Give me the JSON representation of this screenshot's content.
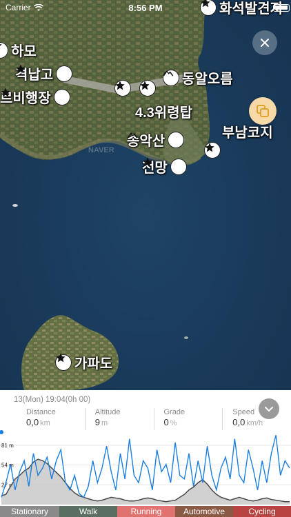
{
  "status_bar": {
    "carrier": "Carrier",
    "time": "8:56 PM"
  },
  "map": {
    "labels": [
      {
        "text": "화석발견지",
        "icon": "star"
      },
      {
        "text": "하모",
        "icon": "star"
      },
      {
        "text": "격납고",
        "icon": "star"
      },
      {
        "text": "르비행장",
        "icon": "star"
      },
      {
        "text": "동알오름",
        "icon": "mountain"
      },
      {
        "text": "4.3위령탑",
        "icon": "star"
      },
      {
        "text": "송악산",
        "icon": "mountain"
      },
      {
        "text": "전망",
        "icon": "star"
      },
      {
        "text": "부남코지",
        "icon": "star"
      },
      {
        "text": "가파도",
        "icon": "star"
      }
    ],
    "watermark": "NAVER"
  },
  "panel": {
    "datetime": "13(Mon) 19:04(0h 00)",
    "stats": [
      {
        "label": "Distance",
        "value": "0,0",
        "unit": "km"
      },
      {
        "label": "Altitude",
        "value": "9",
        "unit": "m"
      },
      {
        "label": "Grade",
        "value": "0",
        "unit": "%"
      },
      {
        "label": "Speed",
        "value": "0,0",
        "unit": "km/h"
      }
    ]
  },
  "chart_data": {
    "type": "line",
    "y_ticks": [
      "81 m",
      "54 m",
      "27 m"
    ],
    "altitude": [
      12,
      14,
      25,
      35,
      40,
      46,
      50,
      58,
      62,
      60,
      56,
      50,
      44,
      38,
      30,
      22,
      16,
      12,
      10,
      8,
      6,
      5,
      6,
      8,
      10,
      9,
      8,
      6,
      5,
      5,
      6,
      8,
      9,
      8,
      6,
      5,
      4,
      5,
      6,
      10,
      14,
      20,
      24,
      30,
      34,
      28,
      20,
      14,
      10,
      8,
      6,
      8,
      10,
      8,
      6,
      5,
      6,
      8,
      9,
      7,
      6,
      5,
      4,
      4
    ],
    "speed": [
      10,
      30,
      55,
      20,
      45,
      60,
      25,
      70,
      40,
      50,
      65,
      35,
      60,
      75,
      30,
      20,
      40,
      15,
      10,
      25,
      60,
      30,
      50,
      80,
      45,
      20,
      70,
      35,
      90,
      40,
      30,
      60,
      50,
      20,
      75,
      45,
      55,
      30,
      85,
      40,
      35,
      70,
      25,
      60,
      30,
      80,
      40,
      20,
      50,
      65,
      35,
      90,
      40,
      30,
      75,
      50,
      20,
      60,
      30,
      70,
      95,
      40,
      60,
      50
    ],
    "legend": [
      {
        "label": "Stationary",
        "color": "#8a8a8a"
      },
      {
        "label": "Walk",
        "color": "#5a6f62"
      },
      {
        "label": "Running",
        "color": "#e07270"
      },
      {
        "label": "Automotive",
        "color": "#8a5a44"
      },
      {
        "label": "Cycling",
        "color": "#b84442"
      }
    ]
  }
}
